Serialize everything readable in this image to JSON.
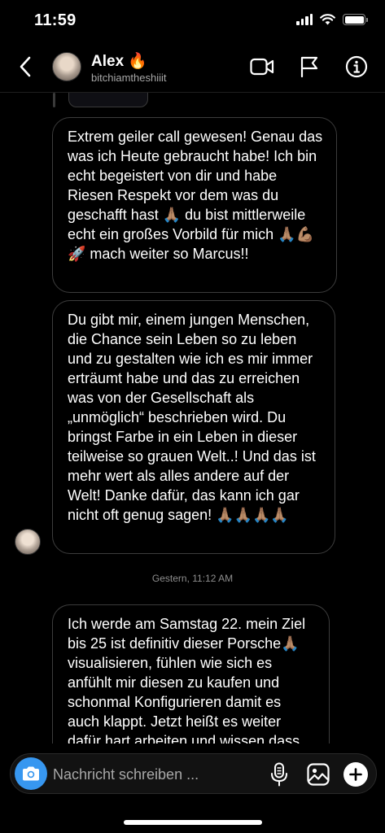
{
  "status_bar": {
    "time": "11:59"
  },
  "header": {
    "name": "Alex 🔥",
    "handle": "bitchiamtheshiiit"
  },
  "messages": [
    {
      "text": "Extrem geiler call gewesen! Genau das was ich Heute gebraucht habe! Ich bin echt begeistert von dir und habe Riesen Respekt vor dem was du geschafft hast 🙏🏽 du bist mittlerweile echt ein großes Vorbild für mich 🙏🏽💪🏽🚀 mach weiter so Marcus!!"
    },
    {
      "text": "Du gibt mir, einem jungen Menschen, die Chance sein Leben so zu leben und zu gestalten wie ich es mir immer erträumt habe und das zu erreichen was von der Gesellschaft als „unmöglich“ beschrieben wird. Du bringst Farbe in ein Leben in dieser teilweise so grauen Welt..! Und das ist mehr wert als alles andere auf der Welt! Danke dafür, das kann ich gar nicht oft genug sagen! 🙏🏽🙏🏽🙏🏽🙏🏽"
    },
    {
      "text": "Ich werde am Samstag 22. mein Ziel bis 25 ist definitiv dieser Porsche🙏🏽 visualisieren, fühlen wie sich es anfühlt mir diesen zu kaufen und schonmal Konfigurieren damit es auch klappt. Jetzt heißt es weiter dafür hart arbeiten und wissen dass"
    }
  ],
  "timestamp": "Gestern, 11:12 AM",
  "composer": {
    "placeholder": "Nachricht schreiben ..."
  },
  "colors": {
    "accent": "#3797f0",
    "bubble_border": "#3c3c3c",
    "background": "#000000"
  }
}
